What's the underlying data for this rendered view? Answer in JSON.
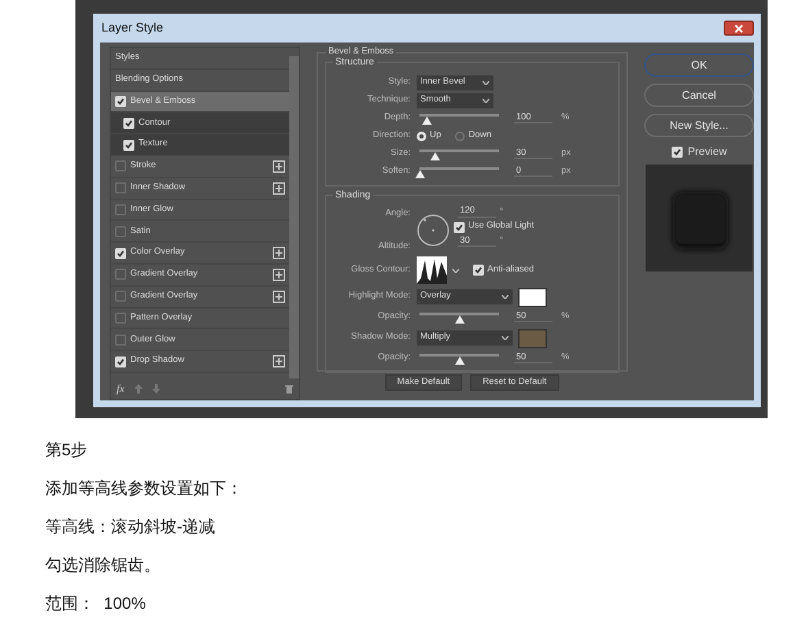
{
  "dialog": {
    "title": "Layer Style",
    "styles": [
      {
        "label": "Styles",
        "kind": "plain",
        "selected": false
      },
      {
        "label": "Blending Options",
        "kind": "plain",
        "selected": false
      },
      {
        "label": "Bevel & Emboss",
        "kind": "effect",
        "checked": true,
        "selected": true,
        "children": [
          {
            "label": "Contour",
            "checked": true,
            "selected": false
          },
          {
            "label": "Texture",
            "checked": true,
            "selected": false
          }
        ]
      },
      {
        "label": "Stroke",
        "kind": "effect",
        "checked": false,
        "selected": false,
        "addable": true
      },
      {
        "label": "Inner Shadow",
        "kind": "effect",
        "checked": false,
        "selected": false,
        "addable": true
      },
      {
        "label": "Inner Glow",
        "kind": "effect",
        "checked": false,
        "selected": false
      },
      {
        "label": "Satin",
        "kind": "effect",
        "checked": false,
        "selected": false
      },
      {
        "label": "Color Overlay",
        "kind": "effect",
        "checked": true,
        "selected": false,
        "addable": true
      },
      {
        "label": "Gradient Overlay",
        "kind": "effect",
        "checked": false,
        "selected": false,
        "addable": true
      },
      {
        "label": "Gradient Overlay",
        "kind": "effect",
        "checked": false,
        "selected": false,
        "addable": true
      },
      {
        "label": "Pattern Overlay",
        "kind": "effect",
        "checked": false,
        "selected": false
      },
      {
        "label": "Outer Glow",
        "kind": "effect",
        "checked": false,
        "selected": false
      },
      {
        "label": "Drop Shadow",
        "kind": "effect",
        "checked": true,
        "selected": false,
        "addable": true
      }
    ],
    "fx": "fx",
    "bevel": {
      "title": "Bevel & Emboss",
      "structure": {
        "title": "Structure",
        "rows": [
          {
            "kind": "dropdown",
            "label": "Style:",
            "value": "Inner Bevel"
          },
          {
            "kind": "dropdown",
            "label": "Technique:",
            "value": "Smooth"
          },
          {
            "kind": "slider",
            "label": "Depth:",
            "level": 0.1,
            "value": "100",
            "unit": "%"
          },
          {
            "kind": "radio",
            "label": "Direction:",
            "options": [
              {
                "label": "Up",
                "selected": true
              },
              {
                "label": "Down",
                "selected": false
              }
            ]
          },
          {
            "kind": "slider",
            "label": "Size:",
            "level": 0.2,
            "value": "30",
            "unit": "px"
          },
          {
            "kind": "slider",
            "label": "Soften:",
            "level": 0,
            "value": "0",
            "unit": "px"
          }
        ]
      },
      "shading": {
        "title": "Shading",
        "angle": {
          "label": "Angle:",
          "value": "120",
          "unit": "°"
        },
        "global_light": {
          "label": "Use Global Light",
          "checked": true
        },
        "altitude": {
          "label": "Altitude:",
          "value": "30",
          "unit": "°"
        },
        "gloss_contour": {
          "label": "Gloss Contour:"
        },
        "anti_aliased": {
          "label": "Anti-aliased",
          "checked": true
        },
        "rows": [
          {
            "kind": "mode",
            "label": "Highlight Mode:",
            "value": "Overlay",
            "color": "#ffffff"
          },
          {
            "kind": "slider",
            "label": "Opacity:",
            "level": 0.5,
            "value": "50",
            "unit": "%"
          },
          {
            "kind": "mode",
            "label": "Shadow Mode:",
            "value": "Multiply",
            "color": "#6b5b45"
          },
          {
            "kind": "slider",
            "label": "Opacity:",
            "level": 0.5,
            "value": "50",
            "unit": "%"
          }
        ]
      },
      "buttons": [
        "Make Default",
        "Reset to Default"
      ]
    },
    "actions": [
      {
        "label": "OK",
        "default": true
      },
      {
        "label": "Cancel",
        "default": false
      },
      {
        "label": "New Style...",
        "default": false
      }
    ],
    "preview": {
      "label": "Preview",
      "checked": true
    }
  },
  "article": [
    "第5步",
    "添加等高线参数设置如下：",
    "等高线：滚动斜坡-递减",
    "勾选消除锯齿。",
    "范围：  100%"
  ]
}
